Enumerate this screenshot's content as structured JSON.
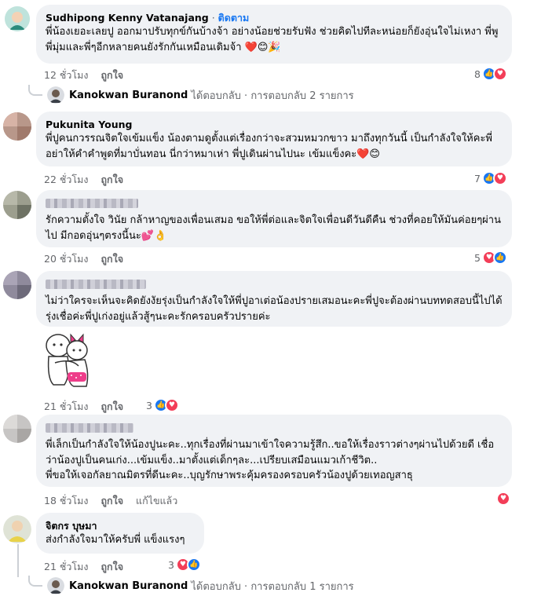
{
  "comments": [
    {
      "author": "Sudhipong Kenny Vatanajang",
      "follow": "ติดตาม",
      "text": "พี่น้องเยอะเลยปู ออกมาปรับทุกข์กันบ้างจ้า อย่างน้อยช่วยรับฟัง ช่วยคิดไปทีละหน่อยก็ยังอุ่นใจไม่เหงา พี่พูพี่มุ่มและพี่ๆอีกหลายคนยังรักกันเหมือนเดิมจ้า ❤️😊🎉",
      "time": "12 ชั่วโมง",
      "like": "ถูกใจ",
      "reaction_count": "8",
      "reactions": [
        "like-icon",
        "love-icon"
      ],
      "reply_author": "Kanokwan Buranond",
      "reply_summary": "ได้ตอบกลับ · การตอบกลับ 2 รายการ"
    },
    {
      "author": "Pukunita Young",
      "text": "พี่ปูคนกวรรณจิตใจเข้มแข็ง น้องตามดูตั้งแต่เรื่องกว่าจะสวมหมวกขาว มาถึงทุกวันนี้ เป็นกำลังใจให้คะพี่ อย่าให้คำคำพูดที่มาบั่นทอน นี่กว่าหมาเห่า พี่ปูเดินผ่านไปนะ เข้มแข็งคะ❤️😊",
      "time": "22 ชั่วโมง",
      "like": "ถูกใจ",
      "reaction_count": "7",
      "reactions": [
        "like-icon",
        "love-icon"
      ]
    },
    {
      "author": "",
      "text": "รักความตั้งใจ วินัย กล้าหาญของเพื่อนเสมอ ขอให้พี่ต่อและจิตใจเพื่อนดีวันดีคืน ช่วงที่คอยให้มันค่อยๆผ่านไป มีกอดอุ่นๆตรงนี้นะ💕👌",
      "time": "20 ชั่วโมง",
      "like": "ถูกใจ",
      "reaction_count": "5",
      "reactions": [
        "love-icon",
        "like-icon"
      ]
    },
    {
      "author": "",
      "text": "ไม่ว่าใครจะเห็นจะคิดยังงัยรุ่งเป็นกำลังใจให้พี่ปูอาเต่อน้องปรายเสมอนะคะพี่ปูจะต้องผ่านบททดสอบนี้ไปได้รุ่งเชื่อค่ะพี่ปูเก่งอยู่แล้วสู้ๆนะคะรักครอบครัวปรายค่ะ",
      "time": "21 ชั่วโมง",
      "like": "ถูกใจ",
      "reaction_count": "3",
      "reactions": [
        "like-icon",
        "love-icon"
      ]
    },
    {
      "author": "",
      "text": "พี่เล็กเป็นกำลังใจให้น้องปูนะคะ..ทุกเรื่องที่ผ่านมาเข้าใจความรู้สึก..ขอให้เรื่องราวต่างๆผ่านไปด้วยดี เชื่อว่าน้องปูเป็นคนเก่ง...เข้มแข็ง..มาตั้งแต่เด็กๆละ...เปรียบเสมือนแมวเก้าชีวิต..\nพี่ขอให้เจอกัลยาณมิตรที่ดีนะคะ..บุญรักษาพระคุ้มครองครอบครัวน้องปูด้วยเทอญสาธุ",
      "time": "18 ชั่วโมง",
      "like": "ถูกใจ",
      "edited": "แก้ไขแล้ว",
      "reactions": [
        "love-icon"
      ]
    },
    {
      "author": "จิตกร บุษมา",
      "text": "ส่งกำลังใจมาให้ครับพี่ แข็งแรงๆ",
      "time": "21 ชั่วโมง",
      "like": "ถูกใจ",
      "reaction_count": "3",
      "reactions": [
        "love-icon",
        "like-icon"
      ],
      "reply_author": "Kanokwan Buranond",
      "reply_summary": "ได้ตอบกลับ · การตอบกลับ 1 รายการ"
    }
  ],
  "colors": {
    "like": "#1877f2",
    "love": "#f33e58",
    "bubble": "#f0f2f5",
    "meta": "#65676b"
  }
}
